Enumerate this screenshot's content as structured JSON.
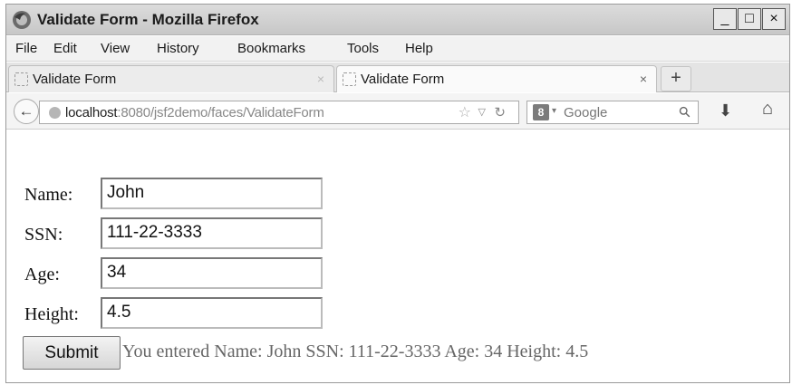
{
  "window": {
    "title": "Validate Form - Mozilla Firefox",
    "controls": {
      "minimize": "_",
      "maximize": "□",
      "close": "×"
    }
  },
  "menu": [
    "File",
    "Edit",
    "View",
    "History",
    "Bookmarks",
    "Tools",
    "Help"
  ],
  "tabs": [
    {
      "label": "Validate Form",
      "close": "×"
    },
    {
      "label": "Validate Form",
      "close": "×"
    }
  ],
  "new_tab_label": "+",
  "navbar": {
    "back_glyph": "←",
    "url_host": "localhost",
    "url_rest": ":8080/jsf2demo/faces/ValidateForm",
    "search_placeholder": "Google",
    "search_engine_glyph": "8"
  },
  "form": {
    "name_label": "Name:",
    "name_value": "John",
    "ssn_label": "SSN:",
    "ssn_value": "111-22-3333",
    "age_label": "Age:",
    "age_value": "34",
    "height_label": "Height:",
    "height_value": "4.5",
    "submit_label": "Submit",
    "output": "You entered Name: John SSN: 111-22-3333 Age: 34 Height: 4.5"
  },
  "icons": [
    "firefox-logo-icon",
    "back-arrow-icon",
    "globe-icon",
    "star-icon",
    "dropmarker-icon",
    "reload-icon",
    "google-icon",
    "magnifier-icon",
    "download-icon",
    "home-icon"
  ]
}
